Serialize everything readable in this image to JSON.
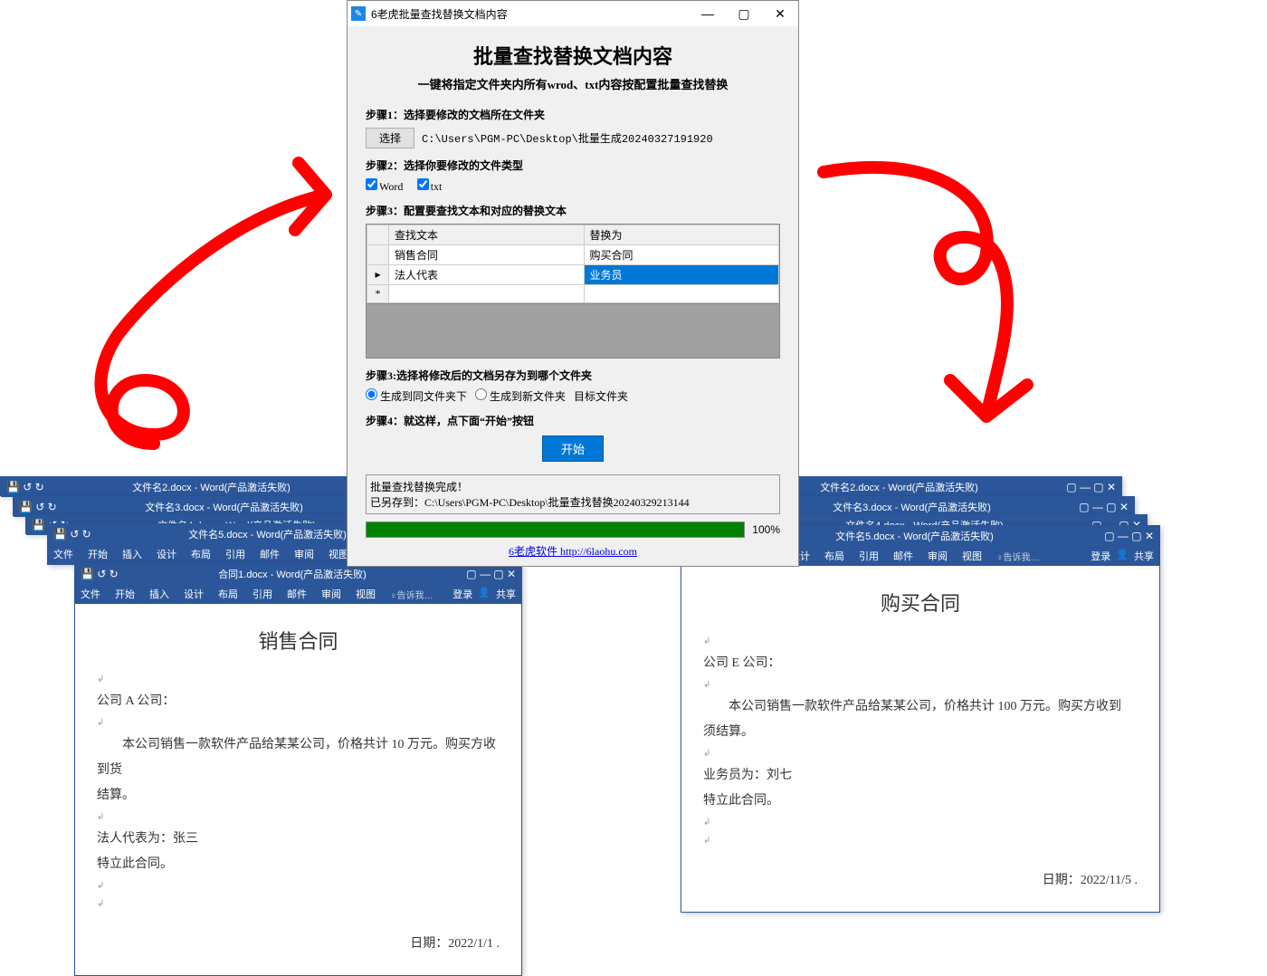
{
  "dialog": {
    "window_title": "6老虎批量查找替换文档内容",
    "heading": "批量查找替换文档内容",
    "subheading": "一键将指定文件夹内所有wrod、txt内容按配置批量查找替换",
    "step1_label": "步骤1：选择要修改的文档所在文件夹",
    "select_btn": "选择",
    "source_path": "C:\\Users\\PGM-PC\\Desktop\\批量生成20240327191920",
    "step2_label": "步骤2：选择你要修改的文件类型",
    "cb_word": "Word",
    "cb_txt": "txt",
    "step3_label": "步骤3：配置要查找文本和对应的替换文本",
    "grid": {
      "col1": "查找文本",
      "col2": "替换为",
      "rows": [
        {
          "find": "销售合同",
          "replace": "购买合同"
        },
        {
          "find": "法人代表",
          "replace": "业务员"
        }
      ],
      "star": "*"
    },
    "step3b_label": "步骤3:选择将修改后的文档另存为到哪个文件夹",
    "radio_same": "生成到同文件夹下",
    "radio_new": "生成到新文件夹",
    "target_folder_label": "目标文件夹",
    "step4_label": "步骤4：就这样，点下面“开始”按钮",
    "start_btn": "开始",
    "status_line1": "批量查找替换完成！",
    "status_line2": "已另存到：C:\\Users\\PGM-PC\\Desktop\\批量查找替换20240329213144",
    "progress_pct": "100%",
    "footer_link": "6老虎软件 http://6laohu.com"
  },
  "word_titles": {
    "left": [
      "文件名2.docx - Word(产品激活失败)",
      "文件名3.docx - Word(产品激活失败)",
      "文件名4.docx - Word(产品激活失败)",
      "文件名5.docx - Word(产品激活失败)",
      "合同1.docx - Word(产品激活失败)"
    ],
    "right": [
      "文件名2.docx - Word(产品激活失败)",
      "文件名3.docx - Word(产品激活失败)",
      "文件名4.docx - Word(产品激活失败)",
      "文件名5.docx - Word(产品激活失败)"
    ]
  },
  "ribbon": {
    "tabs": [
      "文件",
      "开始",
      "插入",
      "设计",
      "布局",
      "引用",
      "邮件",
      "审阅",
      "视图"
    ],
    "tell": "♀告诉我…",
    "login": "登录",
    "share": "共享"
  },
  "doc_left": {
    "title": "销售合同",
    "l1": "公司 A 公司：",
    "l2": "　　本公司销售一款软件产品给某某公司，价格共计 10 万元。购买方收到货",
    "l3": "结算。",
    "l4": "法人代表为：张三",
    "l5": "特立此合同。",
    "date": "日期：2022/1/1 ."
  },
  "doc_right": {
    "title": "购买合同",
    "l1": "公司 E 公司：",
    "l2": "　　本公司销售一款软件产品给某某公司，价格共计 100 万元。购买方收到",
    "l3": "须结算。",
    "l4": "业务员为：刘七",
    "l5": "特立此合同。",
    "date": "日期：2022/11/5 ."
  }
}
